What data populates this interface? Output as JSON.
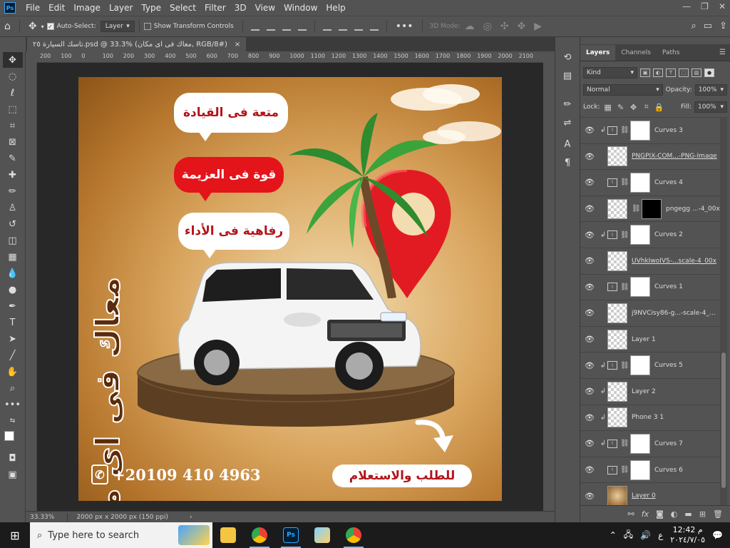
{
  "app": {
    "logo": "Ps",
    "menu": [
      "File",
      "Edit",
      "Image",
      "Layer",
      "Type",
      "Select",
      "Filter",
      "3D",
      "View",
      "Window",
      "Help"
    ],
    "window_controls": [
      "—",
      "❐",
      "✕"
    ]
  },
  "options_bar": {
    "auto_select_label": "Auto-Select:",
    "auto_select_value": "Layer",
    "transform_controls_label": "Show Transform Controls",
    "mode_3d_label": "3D Mode:"
  },
  "document_tab": {
    "title": "تاسك السيارة ٢٥.psd @ 33.3% (معاك فى اى مكان, RGB/8#)",
    "close": "×"
  },
  "ruler_ticks": [
    "200",
    "100",
    "0",
    "100",
    "200",
    "300",
    "400",
    "500",
    "600",
    "700",
    "800",
    "900",
    "1000",
    "1100",
    "1200",
    "1300",
    "1400",
    "1500",
    "1600",
    "1700",
    "1800",
    "1900",
    "2000",
    "2100"
  ],
  "artwork": {
    "bubble_1": "متعة فى القيادة",
    "bubble_2": "قوة فى العزيمة",
    "bubble_3": "رفاهية فى الأداء",
    "vertical_title": "معاك فى اى مكان",
    "phone": "+20109 410 4963",
    "order_label": "للطلب والاستعلام",
    "colors": {
      "accent_red": "#e4141b",
      "text_red": "#b3141b",
      "title_brown": "#5b2c0b"
    }
  },
  "status_bar": {
    "zoom": "33.33%",
    "doc_info": "2000 px x 2000 px (150 ppi)",
    "arrow": "›"
  },
  "layers_panel": {
    "tabs": [
      "Layers",
      "Channels",
      "Paths"
    ],
    "filter_kind": "Kind",
    "blend_mode": "Normal",
    "opacity_label": "Opacity:",
    "opacity_value": "100%",
    "lock_label": "Lock:",
    "fill_label": "Fill:",
    "fill_value": "100%",
    "layers": [
      {
        "name": "Curves 3",
        "type": "adjustment",
        "clip": true,
        "thumb": "white",
        "underline": false
      },
      {
        "name": "PNGPIX-COM...-PNG-Image",
        "type": "smart",
        "clip": false,
        "thumb": "checker",
        "underline": true
      },
      {
        "name": "Curves 4",
        "type": "adjustment",
        "clip": false,
        "thumb": "white",
        "underline": false
      },
      {
        "name": "pngegg ...-4_00x",
        "type": "masked",
        "clip": false,
        "thumb": "black",
        "underline": false
      },
      {
        "name": "Curves 2",
        "type": "adjustment",
        "clip": true,
        "thumb": "white",
        "underline": false
      },
      {
        "name": "UVhkIwoIVS-...scale-4_00x",
        "type": "smart",
        "clip": false,
        "thumb": "checker",
        "underline": true
      },
      {
        "name": "Curves 1",
        "type": "adjustment",
        "clip": false,
        "thumb": "white",
        "underline": false
      },
      {
        "name": "j9NVCisy86-g...-scale-4_00x",
        "type": "smart",
        "clip": false,
        "thumb": "checker",
        "underline": false
      },
      {
        "name": "Layer 1",
        "type": "pixel",
        "clip": false,
        "thumb": "checker",
        "underline": false
      },
      {
        "name": "Curves 5",
        "type": "adjustment",
        "clip": true,
        "thumb": "white",
        "underline": false
      },
      {
        "name": "Layer 2",
        "type": "pixel",
        "clip": true,
        "thumb": "checker",
        "underline": false
      },
      {
        "name": "Phone 3 1",
        "type": "smart",
        "clip": true,
        "thumb": "checker",
        "underline": false
      },
      {
        "name": "Curves 7",
        "type": "adjustment",
        "clip": true,
        "thumb": "white",
        "underline": false
      },
      {
        "name": "Curves 6",
        "type": "adjustment",
        "clip": false,
        "thumb": "white",
        "underline": false
      },
      {
        "name": "Layer 0",
        "type": "pixel",
        "clip": false,
        "thumb": "brown",
        "underline": true
      }
    ],
    "footer_icons": [
      "link-icon",
      "fx-icon",
      "mask-icon",
      "adjustment-icon",
      "folder-icon",
      "new-layer-icon",
      "trash-icon"
    ]
  },
  "taskbar": {
    "search_placeholder": "Type here to search",
    "time": "12:42 م",
    "date": "٢٠٢٤/٧/٠٥",
    "lang": "ع"
  }
}
